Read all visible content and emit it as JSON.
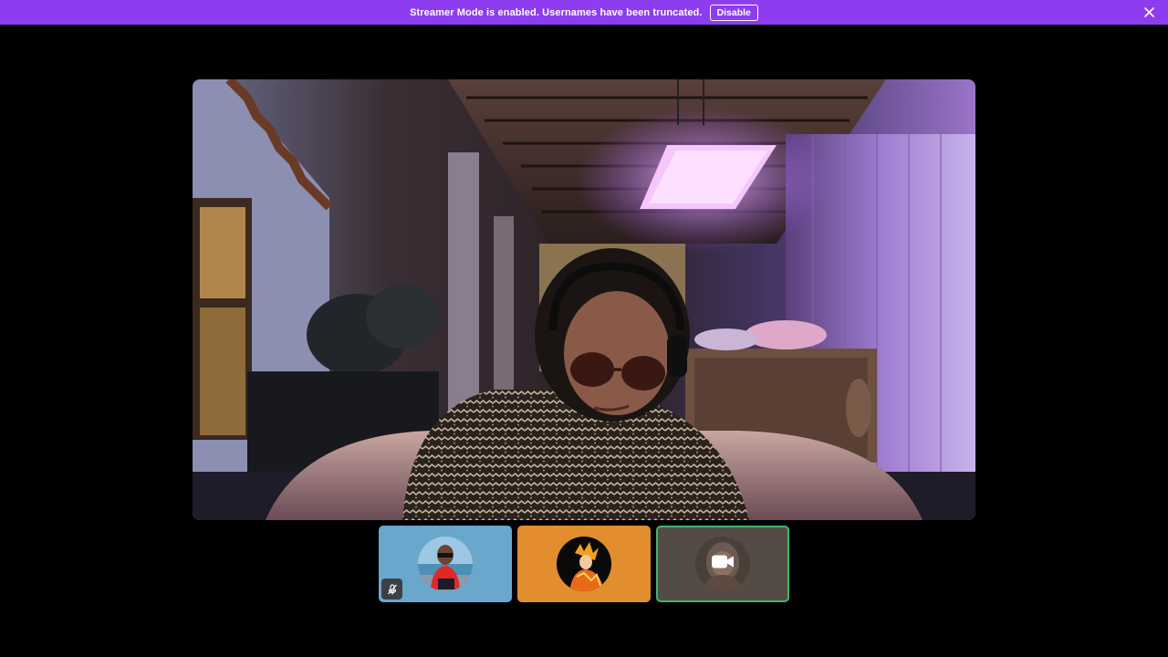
{
  "banner": {
    "message": "Streamer Mode is enabled. Usernames have been truncated.",
    "disable_label": "Disable",
    "close_icon": "close-icon",
    "background_color": "#8e3cf0"
  },
  "main_video": {
    "scene": "live-camera-feed"
  },
  "participants": [
    {
      "tile_color": "#6aa7cc",
      "status_icon": "microphone-muted-icon"
    },
    {
      "tile_color": "#e28d2e",
      "status_icon": ""
    },
    {
      "tile_color": "#544b44",
      "status_icon": "video-camera-icon",
      "speaking": true
    }
  ]
}
